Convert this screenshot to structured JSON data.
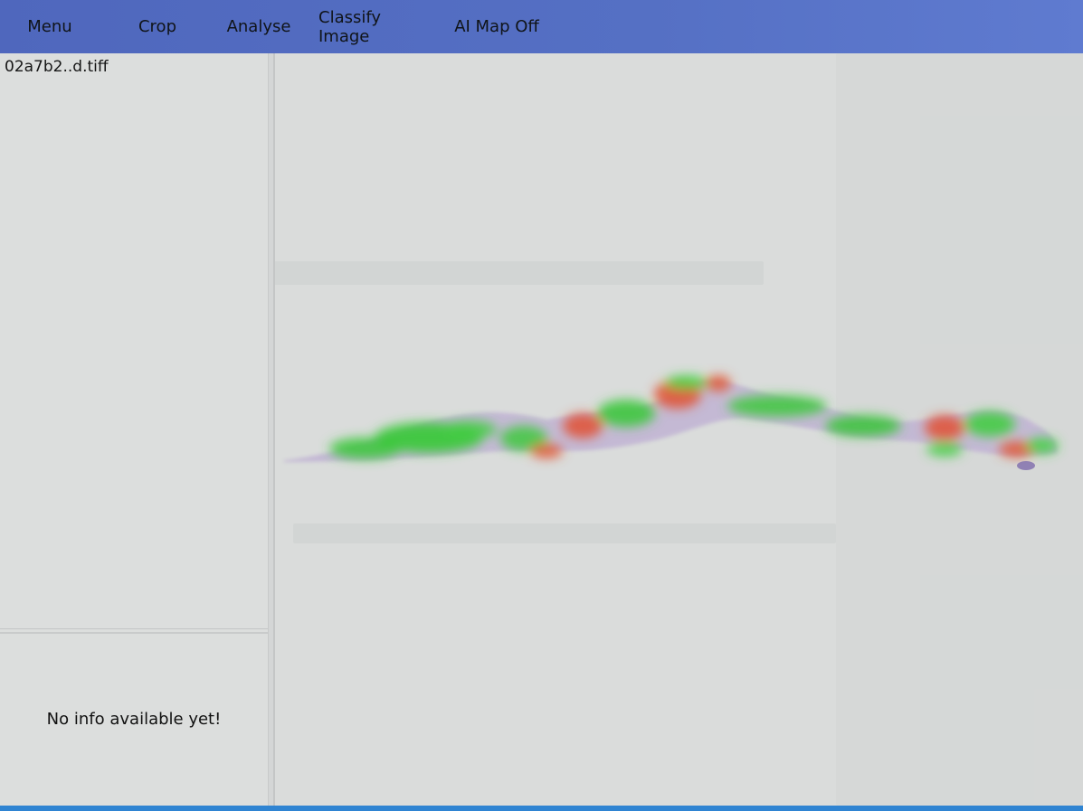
{
  "menubar": {
    "items": [
      {
        "id": "menu",
        "label": "Menu"
      },
      {
        "id": "crop",
        "label": "Crop"
      },
      {
        "id": "analyse",
        "label": "Analyse"
      },
      {
        "id": "classify",
        "label": "Classify Image"
      },
      {
        "id": "ai-map",
        "label": "AI Map Off"
      }
    ]
  },
  "sidebar": {
    "filename": "02a7b2..d.tiff",
    "info_text": "No info available yet!"
  },
  "colors": {
    "menubar": "#5570c4",
    "status_bar": "#2f84d2",
    "heatmap_high": "#3fcf3f",
    "heatmap_low": "#e0553a",
    "tissue": "#b9a9cf"
  }
}
